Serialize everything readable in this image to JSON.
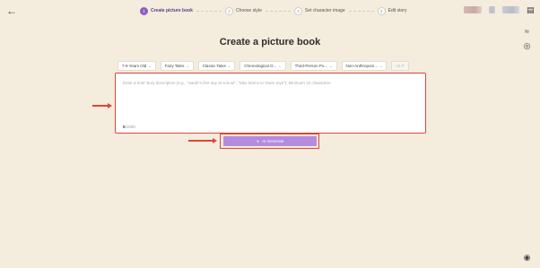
{
  "header": {
    "steps": [
      {
        "number": "1",
        "label": "Create picture book"
      },
      {
        "number": "2",
        "label": "Choose style"
      },
      {
        "number": "3",
        "label": "Set character image"
      },
      {
        "number": "4",
        "label": "Edit story"
      }
    ],
    "active_step": 1,
    "icons": {
      "back": "arrow-left-icon",
      "document": "document-icon"
    }
  },
  "page_title": "Create a picture book",
  "filters": [
    {
      "label": "7-9 Years Old"
    },
    {
      "label": "Fairy Tales"
    },
    {
      "label": "Classic Tales"
    },
    {
      "label": "Chronological O..."
    },
    {
      "label": "Third-Person Po..."
    },
    {
      "label": "Non-Anthropom..."
    },
    {
      "label": "16 P"
    }
  ],
  "story_input": {
    "placeholder": "Enter a brief story description (e.g., \"Sarah's first day at school\", \"Max learns to share toys\"). Minimum 10 characters.",
    "count": "0",
    "max": "/1000"
  },
  "generate_button": {
    "label": "AI Generate",
    "icon": "plus-icon"
  },
  "side_icons": [
    "wifi-icon",
    "target-icon",
    "cat-face-icon"
  ],
  "colors": {
    "accent": "#8d5cc8",
    "button": "#b58be0",
    "annotation": "#e0443a",
    "background": "#f4ecdc"
  }
}
